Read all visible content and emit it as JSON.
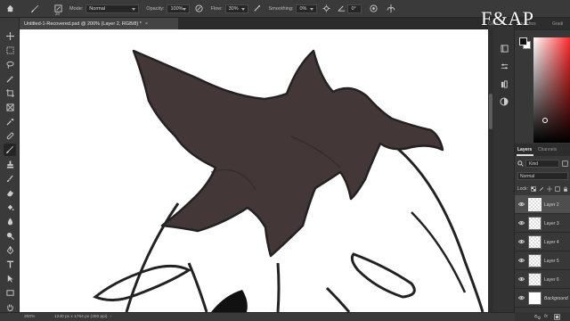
{
  "options_bar": {
    "brush_size": "20",
    "mode_label": "Mode:",
    "mode_value": "Normal",
    "opacity_label": "Opacity:",
    "opacity_value": "100%",
    "flow_label": "Flow:",
    "flow_value": "30%",
    "smoothing_label": "Smoothing:",
    "smoothing_value": "0%",
    "angle_value": "0°"
  },
  "document_tab": {
    "title": "Untitled-1-Recovered.psd @ 200% (Layer 2, RGB/8) *",
    "close": "×"
  },
  "status_bar": {
    "zoom": "200%",
    "doc_info": "1240 px x 1754 px (300 ppi)",
    "arrow": "›"
  },
  "color_panel": {
    "tabs": [
      "Color",
      "Swatches",
      "Gradi"
    ],
    "foreground": "#111111",
    "background": "#ffffff"
  },
  "layers_panel": {
    "tabs": [
      "Layers",
      "Channels"
    ],
    "filter_kind": "Kind",
    "blend_mode": "Normal",
    "lock_label": "Lock:",
    "layers": [
      {
        "name": "Layer 2",
        "selected": true
      },
      {
        "name": "Layer 3",
        "selected": false
      },
      {
        "name": "Layer 4",
        "selected": false
      },
      {
        "name": "Layer 5",
        "selected": false
      },
      {
        "name": "Layer 6",
        "selected": false
      },
      {
        "name": "Background",
        "selected": false
      }
    ],
    "footer_fx": "fx"
  },
  "watermark": "F&AP",
  "colors": {
    "hair": "#433837",
    "outline": "#222222"
  }
}
